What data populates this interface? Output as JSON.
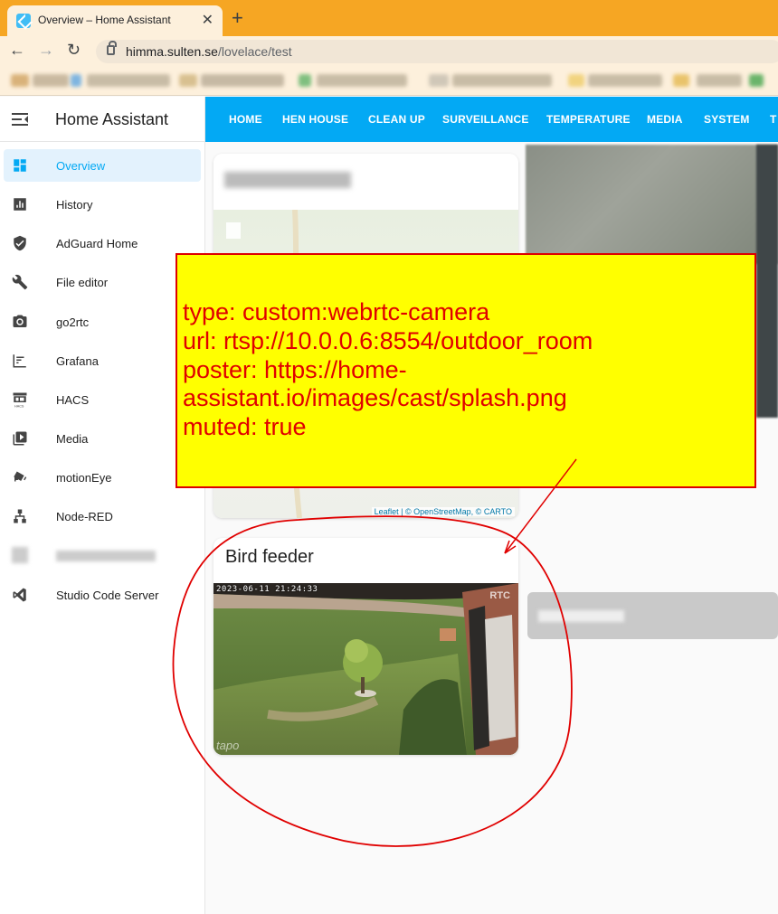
{
  "browser": {
    "tab_title": "Overview – Home Assistant",
    "url_host": "himma.sulten.se",
    "url_path": "/lovelace/test"
  },
  "sidebar": {
    "title": "Home Assistant",
    "items": [
      {
        "label": "Overview",
        "icon": "dashboard-icon"
      },
      {
        "label": "History",
        "icon": "chart-icon"
      },
      {
        "label": "AdGuard Home",
        "icon": "shield-icon"
      },
      {
        "label": "File editor",
        "icon": "wrench-icon"
      },
      {
        "label": "go2rtc",
        "icon": "camera-icon"
      },
      {
        "label": "Grafana",
        "icon": "grafana-icon"
      },
      {
        "label": "HACS",
        "icon": "hacs-icon"
      },
      {
        "label": "Media",
        "icon": "media-icon"
      },
      {
        "label": "motionEye",
        "icon": "cctv-icon"
      },
      {
        "label": "Node-RED",
        "icon": "sitemap-icon"
      },
      {
        "label": "",
        "icon": "blurred-icon"
      },
      {
        "label": "Studio Code Server",
        "icon": "vscode-icon"
      }
    ]
  },
  "topbar": {
    "tabs": [
      "HOME",
      "HEN HOUSE",
      "CLEAN UP",
      "SURVEILLANCE",
      "TEMPERATURE",
      "MEDIA",
      "SYSTEM",
      "T"
    ]
  },
  "map_card": {
    "attribution": "Leaflet | © OpenStreetMap, © CARTO"
  },
  "bird_card": {
    "title": "Bird feeder",
    "timestamp": "2023-06-11 21:24:33",
    "badge": "RTC",
    "watermark": "tapo"
  },
  "annotation": {
    "lines": [
      "type: custom:webrtc-camera",
      "url: rtsp://10.0.0.6:8554/outdoor_room",
      "poster: https://home-",
      "assistant.io/images/cast/splash.png",
      "muted: true"
    ]
  },
  "colors": {
    "ha_primary": "#03a9f4",
    "browser_frame": "#f6a623",
    "annotation_bg": "#ffff00",
    "annotation_text": "#e00000"
  }
}
